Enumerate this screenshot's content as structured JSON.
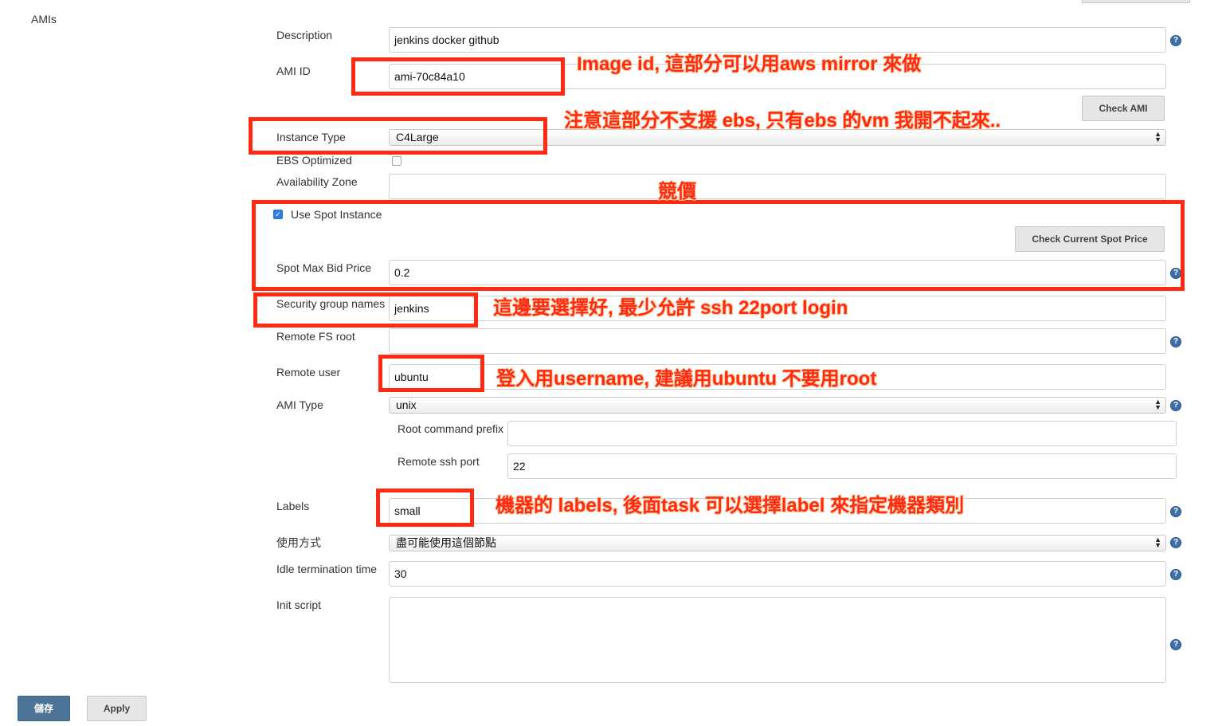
{
  "section_title": "AMIs",
  "fields": {
    "description": {
      "label": "Description",
      "value": "jenkins docker github"
    },
    "ami_id": {
      "label": "AMI ID",
      "value": "ami-70c84a10"
    },
    "check_ami_label": "Check AMI",
    "instance_type": {
      "label": "Instance Type",
      "value": "C4Large"
    },
    "ebs_optimized": {
      "label": "EBS Optimized",
      "checked": false
    },
    "availability_zone": {
      "label": "Availability Zone",
      "value": ""
    },
    "use_spot": {
      "label": "Use Spot Instance",
      "checked": true
    },
    "check_spot_label": "Check Current Spot Price",
    "spot_max_bid": {
      "label": "Spot Max Bid Price",
      "value": "0.2"
    },
    "security_groups": {
      "label": "Security group names",
      "value": "jenkins"
    },
    "remote_fs_root": {
      "label": "Remote FS root",
      "value": ""
    },
    "remote_user": {
      "label": "Remote user",
      "value": "ubuntu"
    },
    "ami_type": {
      "label": "AMI Type",
      "value": "unix"
    },
    "root_command_prefix": {
      "label": "Root command prefix",
      "value": ""
    },
    "remote_ssh_port": {
      "label": "Remote ssh port",
      "value": "22"
    },
    "labels": {
      "label": "Labels",
      "value": "small"
    },
    "usage": {
      "label": "使用方式",
      "value": "盡可能使用這個節點"
    },
    "idle_termination": {
      "label": "Idle termination time",
      "value": "30"
    },
    "init_script": {
      "label": "Init script",
      "value": ""
    }
  },
  "buttons": {
    "save": "儲存",
    "apply": "Apply"
  },
  "annotations": {
    "image_id": "Image id, 這部分可以用aws mirror 來做",
    "instance_type": "注意這部分不支援 ebs, 只有ebs 的vm 我開不起來..",
    "spot": "競價",
    "security": "這邊要選擇好, 最少允許 ssh 22port login",
    "remote_user": "登入用username, 建議用ubuntu 不要用root",
    "labels": "機器的 labels, 後面task 可以選擇label 來指定機器類別"
  },
  "colors": {
    "annotation": "#ff2a12",
    "save_button": "#4b7496",
    "help_icon": "#3d6fa8"
  },
  "icons": {
    "help": "question-mark",
    "select_arrows": "up-down-chevrons"
  }
}
